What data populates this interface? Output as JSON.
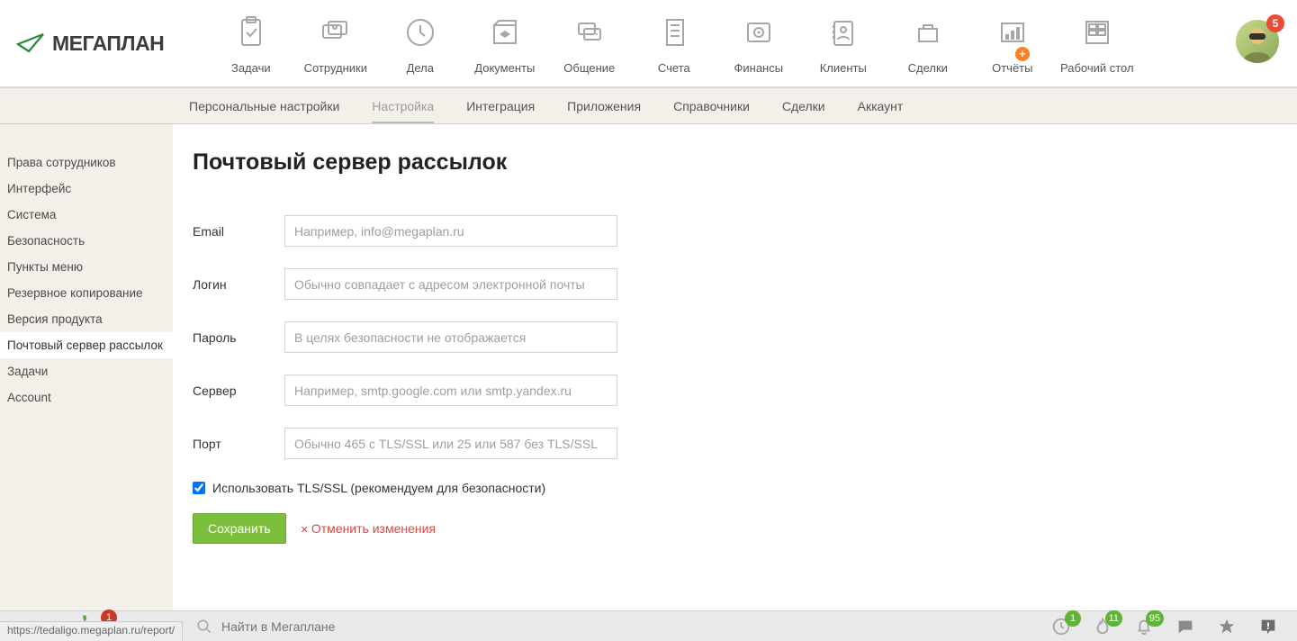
{
  "brand": {
    "name": "МЕГАПЛАН"
  },
  "topnav": [
    {
      "label": "Задачи",
      "icon": "tasks"
    },
    {
      "label": "Сотрудники",
      "icon": "employees"
    },
    {
      "label": "Дела",
      "icon": "affairs"
    },
    {
      "label": "Документы",
      "icon": "documents"
    },
    {
      "label": "Общение",
      "icon": "chat"
    },
    {
      "label": "Счета",
      "icon": "invoices"
    },
    {
      "label": "Финансы",
      "icon": "finance"
    },
    {
      "label": "Клиенты",
      "icon": "clients"
    },
    {
      "label": "Сделки",
      "icon": "deals"
    },
    {
      "label": "Отчёты",
      "icon": "reports",
      "plus": true
    },
    {
      "label": "Рабочий стол",
      "icon": "desktop"
    }
  ],
  "avatar_badge": "5",
  "subnav": {
    "items": [
      "Персональные настройки",
      "Настройка",
      "Интеграция",
      "Приложения",
      "Справочники",
      "Сделки",
      "Аккаунт"
    ],
    "active": "Настройка"
  },
  "sidebar": {
    "items": [
      "Права сотрудников",
      "Интерфейс",
      "Система",
      "Безопасность",
      "Пункты меню",
      "Резервное копирование",
      "Версия продукта",
      "Почтовый сервер рассылок",
      "Задачи",
      "Account"
    ],
    "active": "Почтовый сервер рассылок"
  },
  "page": {
    "title": "Почтовый сервер рассылок",
    "fields": {
      "email": {
        "label": "Email",
        "placeholder": "Например, info@megaplan.ru"
      },
      "login": {
        "label": "Логин",
        "placeholder": "Обычно совпадает с адресом электронной почты"
      },
      "password": {
        "label": "Пароль",
        "placeholder": "В целях безопасности не отображается"
      },
      "server": {
        "label": "Сервер",
        "placeholder": "Например, smtp.google.com или smtp.yandex.ru"
      },
      "port": {
        "label": "Порт",
        "placeholder": "Обычно 465 с TLS/SSL или 25 или 587 без TLS/SSL"
      }
    },
    "tls_label": "Использовать TLS/SSL (рекомендуем для безопасности)",
    "tls_checked": true,
    "save": "Сохранить",
    "cancel": "Отменить изменения"
  },
  "bottom": {
    "status_url": "https://tedaligo.megaplan.ru/report/",
    "phone_badge": "1",
    "search_placeholder": "Найти в Мегаплане",
    "tray": {
      "clock": "1",
      "fire": "11",
      "bell": "95"
    }
  },
  "colors": {
    "accent_green": "#7bbf3c",
    "accent_red": "#d9493d",
    "badge_red": "#e94b35",
    "orange": "#ff7f27"
  }
}
